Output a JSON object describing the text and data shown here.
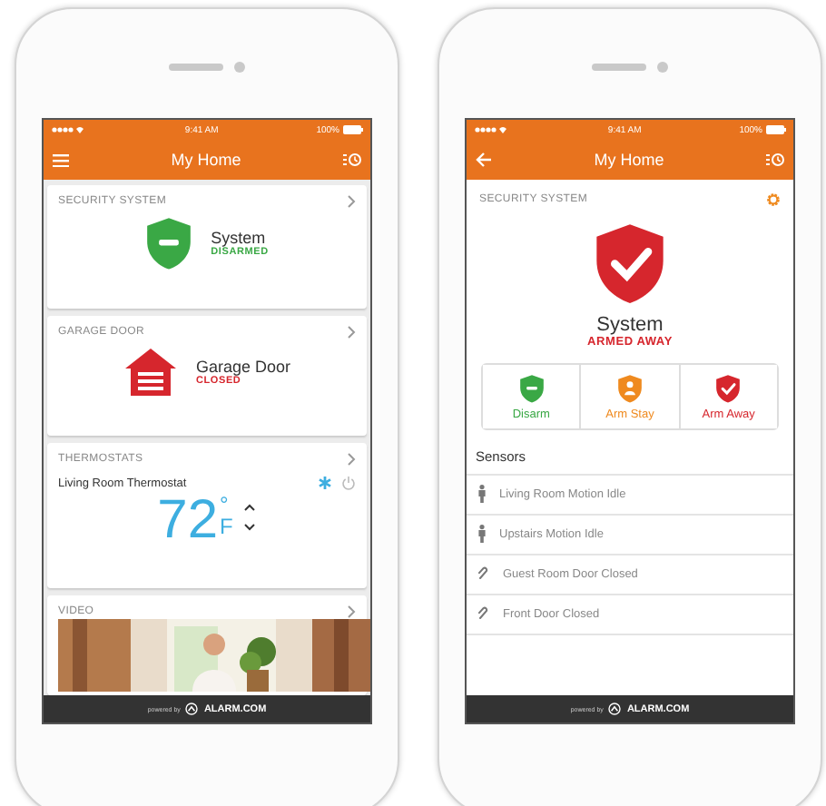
{
  "phones": [
    {
      "status_bar": {
        "time": "9:41 AM",
        "battery": "100%"
      },
      "nav": {
        "kind": "menu",
        "title": "My Home"
      },
      "cards": [
        {
          "kind": "security",
          "title": "SECURITY SYSTEM",
          "name": "System",
          "state": "DISARMED",
          "shield": {
            "kind": "disarmed"
          }
        },
        {
          "kind": "garage",
          "title": "GARAGE DOOR",
          "name": "Garage Door",
          "state": "CLOSED"
        },
        {
          "kind": "thermostat",
          "title": "THERMOSTATS",
          "device": "Living Room Thermostat",
          "temperature": "72",
          "degree": "°",
          "unit": "F"
        },
        {
          "kind": "video",
          "title": "VIDEO"
        }
      ],
      "footer": {
        "prefix": "powered by",
        "brand": "ALARM.COM"
      }
    },
    {
      "status_bar": {
        "time": "9:41 AM",
        "battery": "100%"
      },
      "nav": {
        "kind": "back",
        "title": "My Home"
      },
      "panel": {
        "title": "SECURITY SYSTEM",
        "name": "System",
        "state": "ARMED AWAY",
        "shield": {
          "kind": "armed"
        },
        "actions": [
          {
            "label": "Disarm",
            "kind": "disarm",
            "color": "#3aa845"
          },
          {
            "label": "Arm Stay",
            "kind": "stay",
            "color": "#ef8a1f"
          },
          {
            "label": "Arm Away",
            "kind": "away",
            "color": "#d6262d"
          }
        ],
        "sensors_heading": "Sensors",
        "sensors": [
          {
            "label": "Living Room Motion Idle",
            "kind": "motion"
          },
          {
            "label": "Upstairs Motion Idle",
            "kind": "motion"
          },
          {
            "label": "Guest Room Door Closed",
            "kind": "contact"
          },
          {
            "label": "Front Door Closed",
            "kind": "contact"
          }
        ]
      },
      "footer": {
        "prefix": "powered by",
        "brand": "ALARM.COM"
      }
    }
  ]
}
